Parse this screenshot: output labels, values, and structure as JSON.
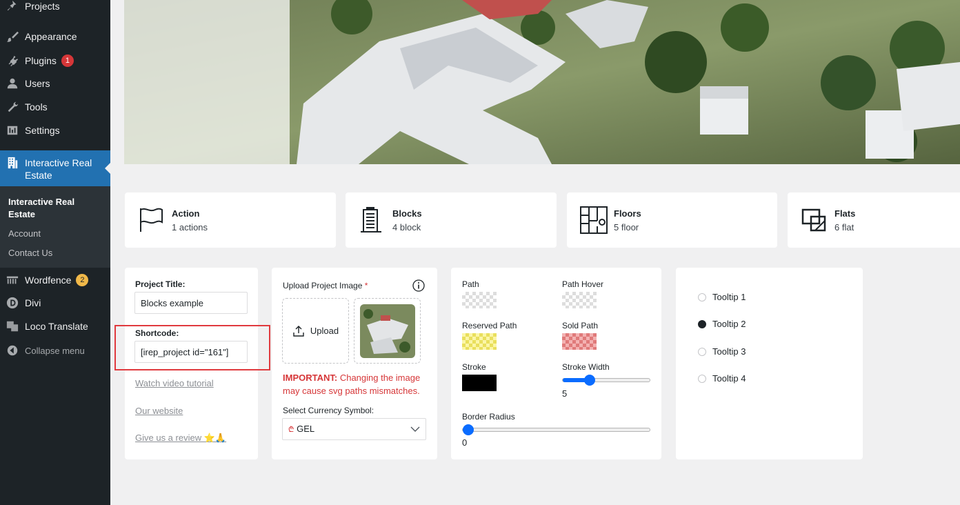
{
  "sidebar": {
    "items": [
      {
        "label": "Projects",
        "icon": "pin-icon"
      },
      {
        "label": "Appearance",
        "icon": "brush-icon"
      },
      {
        "label": "Plugins",
        "icon": "plug-icon",
        "badge": "1"
      },
      {
        "label": "Users",
        "icon": "user-icon"
      },
      {
        "label": "Tools",
        "icon": "wrench-icon"
      },
      {
        "label": "Settings",
        "icon": "sliders-icon"
      }
    ],
    "active": {
      "label": "Interactive Real Estate",
      "icon": "building-icon"
    },
    "submenu": [
      "Interactive Real Estate",
      "Account",
      "Contact Us"
    ],
    "lower_items": [
      {
        "label": "Wordfence",
        "icon": "wordfence-icon",
        "badge": "2"
      },
      {
        "label": "Divi",
        "icon": "divi-icon"
      },
      {
        "label": "Loco Translate",
        "icon": "translate-icon"
      }
    ],
    "collapse_label": "Collapse menu"
  },
  "stats": [
    {
      "title": "Action",
      "sub": "1 actions",
      "icon": "flag-icon"
    },
    {
      "title": "Blocks",
      "sub": "4 block",
      "icon": "building-block-icon"
    },
    {
      "title": "Floors",
      "sub": "5 floor",
      "icon": "floor-plan-icon"
    },
    {
      "title": "Flats",
      "sub": "6 flat",
      "icon": "flat-icon"
    }
  ],
  "project": {
    "title_label": "Project Title:",
    "title_value": "Blocks example",
    "shortcode_label": "Shortcode:",
    "shortcode_value": "[irep_project id=\"161\"]",
    "links": [
      "Watch video tutorial",
      "Our website",
      "Give us a review ⭐🙏"
    ]
  },
  "upload": {
    "label": "Upload Project Image",
    "required_mark": "*",
    "button": "Upload",
    "important_prefix": "IMPORTANT:",
    "important_line1": "Changing the image",
    "important_line2": "may cause svg paths mismatches.",
    "currency_label": "Select Currency Symbol:",
    "currency_symbol": "₾",
    "currency_value": "GEL"
  },
  "styles": {
    "path_label": "Path",
    "path_hover_label": "Path Hover",
    "reserved_label": "Reserved Path",
    "sold_label": "Sold Path",
    "stroke_label": "Stroke",
    "stroke_width_label": "Stroke Width",
    "stroke_width_value": "5",
    "stroke_width_fraction": 0.28,
    "border_radius_label": "Border Radius",
    "border_radius_value": "0",
    "border_radius_fraction": 0.0,
    "stroke_color": "#000000",
    "accent": "#0a6cff"
  },
  "tooltips": {
    "options": [
      "Tooltip 1",
      "Tooltip 2",
      "Tooltip 3",
      "Tooltip 4"
    ],
    "selected": "Tooltip 2"
  }
}
